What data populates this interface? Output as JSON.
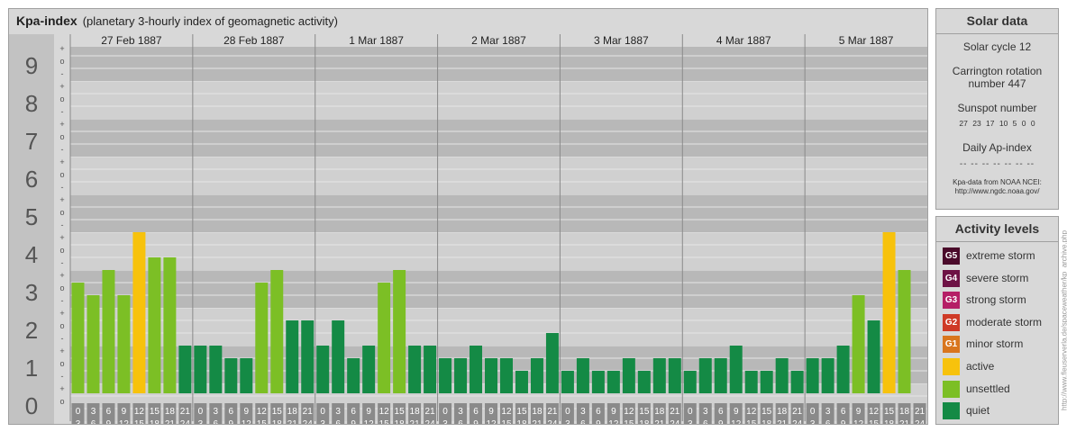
{
  "header": {
    "title": "Kpa-index",
    "subtitle": "(planetary 3-hourly index of geomagnetic activity)"
  },
  "colors": {
    "quiet": "#148a45",
    "unsettled": "#7cbf25",
    "active": "#f7c20c",
    "minor_storm": "#d9761e",
    "moderate_storm": "#cf3a26",
    "strong_storm": "#b51e66",
    "severe_storm": "#6e1245",
    "extreme_storm": "#4a0a2a"
  },
  "chart_data": {
    "type": "bar",
    "ylim": [
      0,
      9
    ],
    "y_tick_labels": [
      "0",
      "1",
      "2",
      "3",
      "4",
      "5",
      "6",
      "7",
      "8",
      "9"
    ],
    "sub_tick_labels": [
      "-",
      "o",
      "+"
    ],
    "days": [
      "27 Feb 1887",
      "28 Feb 1887",
      "1 Mar 1887",
      "2 Mar 1887",
      "3 Mar 1887",
      "4 Mar 1887",
      "5 Mar 1887"
    ],
    "interval_starts": [
      "0",
      "3",
      "6",
      "9",
      "12",
      "15",
      "18",
      "21"
    ],
    "interval_ends": [
      "3",
      "6",
      "9",
      "12",
      "15",
      "18",
      "21",
      "24"
    ],
    "values": [
      [
        2.333,
        2.0,
        2.667,
        2.0,
        3.667,
        3.0,
        3.0,
        0.667
      ],
      [
        0.667,
        0.667,
        0.333,
        0.333,
        2.333,
        2.667,
        1.333,
        1.333
      ],
      [
        0.667,
        1.333,
        0.333,
        0.667,
        2.333,
        2.667,
        0.667,
        0.667
      ],
      [
        0.333,
        0.333,
        0.667,
        0.333,
        0.333,
        0.0,
        0.333,
        1.0
      ],
      [
        0.0,
        0.333,
        0.0,
        0.0,
        0.333,
        0.0,
        0.333,
        0.333
      ],
      [
        0.0,
        0.333,
        0.333,
        0.667,
        0.0,
        0.0,
        0.333,
        0.0
      ],
      [
        0.333,
        0.333,
        0.667,
        2.0,
        1.333,
        3.667,
        2.667,
        null
      ]
    ]
  },
  "solar": {
    "title": "Solar data",
    "cycle": "Solar cycle 12",
    "carrington_line1": "Carrington rotation",
    "carrington_line2": "number 447",
    "sunspot_label": "Sunspot number",
    "sunspot_values": "27 23 17 10 5 0 0",
    "ap_label": "Daily Ap-index",
    "ap_values": "-- -- -- -- -- -- --",
    "source_line1": "Kpa-data from NOAA NCEI:",
    "source_line2": "http://www.ngdc.noaa.gov/"
  },
  "activity": {
    "title": "Activity levels",
    "levels": [
      {
        "badge": "G5",
        "label": "extreme storm",
        "color": "#4a0a2a"
      },
      {
        "badge": "G4",
        "label": "severe storm",
        "color": "#6e1245"
      },
      {
        "badge": "G3",
        "label": "strong storm",
        "color": "#b51e66"
      },
      {
        "badge": "G2",
        "label": "moderate storm",
        "color": "#cf3a26"
      },
      {
        "badge": "G1",
        "label": "minor storm",
        "color": "#d9761e"
      },
      {
        "badge": "",
        "label": "active",
        "color": "#f7c20c"
      },
      {
        "badge": "",
        "label": "unsettled",
        "color": "#7cbf25"
      },
      {
        "badge": "",
        "label": "quiet",
        "color": "#148a45"
      }
    ]
  },
  "credit": "http://www.fleuserverla.de/spaceweather/kp_archive.php"
}
